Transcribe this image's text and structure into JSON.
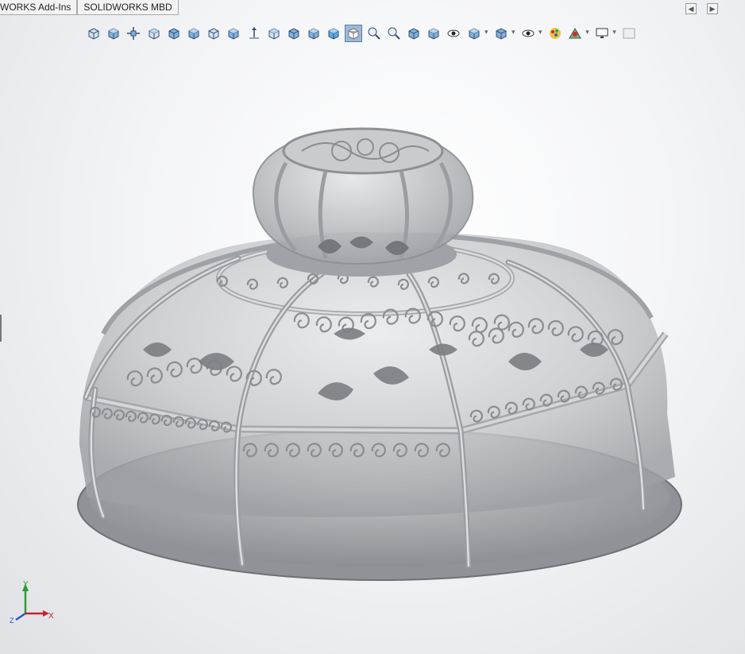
{
  "tabs": [
    {
      "label": "WORKS Add-Ins"
    },
    {
      "label": "SOLIDWORKS MBD"
    }
  ],
  "window": {
    "back_glyph": "◀",
    "forward_glyph": "▶"
  },
  "toolbar": {
    "icons": [
      "front-view-icon",
      "back-view-icon",
      "zoom-to-fit-icon",
      "left-view-icon",
      "right-view-icon",
      "top-view-icon",
      "bottom-view-icon",
      "isometric-view-icon",
      "normal-to-icon",
      "trimetric-view-icon",
      "dimetric-view-icon",
      "shaded-view-icon",
      "shaded-with-edges-icon",
      "wireframe-icon",
      "zoom-to-area-icon",
      "zoom-in-out-icon",
      "previous-view-icon",
      "section-view-icon",
      "dynamic-annotation-icon",
      "view-orientation-icon",
      "display-style-icon",
      "hide-show-items-icon",
      "edit-appearance-icon",
      "apply-scene-icon",
      "view-settings-icon",
      "realview-icon"
    ],
    "active_index": 13
  },
  "triad": {
    "x_label": "X",
    "y_label": "Y",
    "z_label": "Z"
  },
  "colors": {
    "model": "#b8babd",
    "model_dark": "#7c7f83",
    "accent": "#2f6fb5"
  }
}
